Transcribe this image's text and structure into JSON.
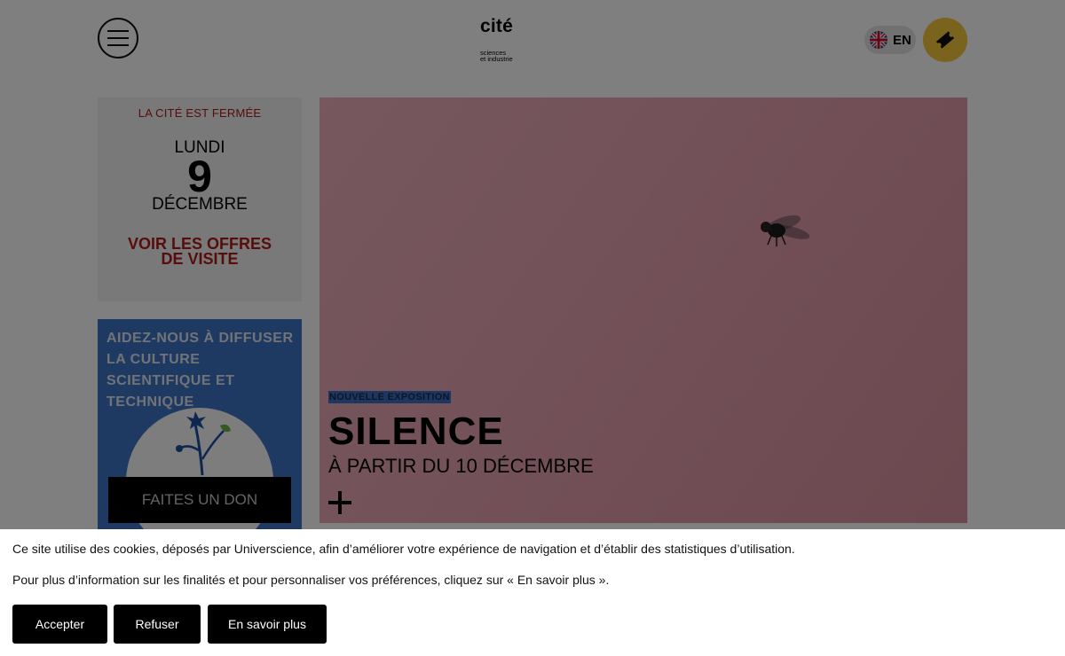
{
  "header": {
    "menu_icon": "hamburger-menu-icon",
    "logo_main": "cité",
    "logo_sub_1": "sciences",
    "logo_sub_2": "et industrie",
    "language": "EN",
    "language_icon": "uk-flag-icon",
    "ticket_icon": "ticket-icon"
  },
  "opening": {
    "status": "LA CITÉ EST FERMÉE",
    "day_name": "LUNDI",
    "day_number": "9",
    "month": "DÉCEMBRE",
    "offers_link": "VOIR LES OFFRES DE VISITE"
  },
  "donate": {
    "title": "AIDEZ-NOUS À DIFFUSER LA CULTURE SCIENTIFIQUE ET TECHNIQUE",
    "button": "FAITES UN DON"
  },
  "hero": {
    "badge": "NOUVELLE EXPOSITION",
    "title": "SILENCE",
    "subtitle": "À PARTIR DU 10 DÉCEMBRE",
    "more_icon": "plus-icon"
  },
  "cookie": {
    "line1": "Ce site utilise des cookies, déposés par Universcience, afin d’améliorer votre expérience de navigation et d’établir des statistiques d’utilisation.",
    "line2": "Pour plus d’information sur les finalités et pour personnaliser vos préférences, cliquez sur « En savoir plus ».",
    "accept": "Accepter",
    "refuse": "Refuser",
    "more": "En savoir plus"
  },
  "colors": {
    "accent_red": "#b11a1a",
    "ticket_yellow": "#f4c63b",
    "donate_blue": "#3d75c7",
    "hero_pink": "#e9a5b3"
  }
}
